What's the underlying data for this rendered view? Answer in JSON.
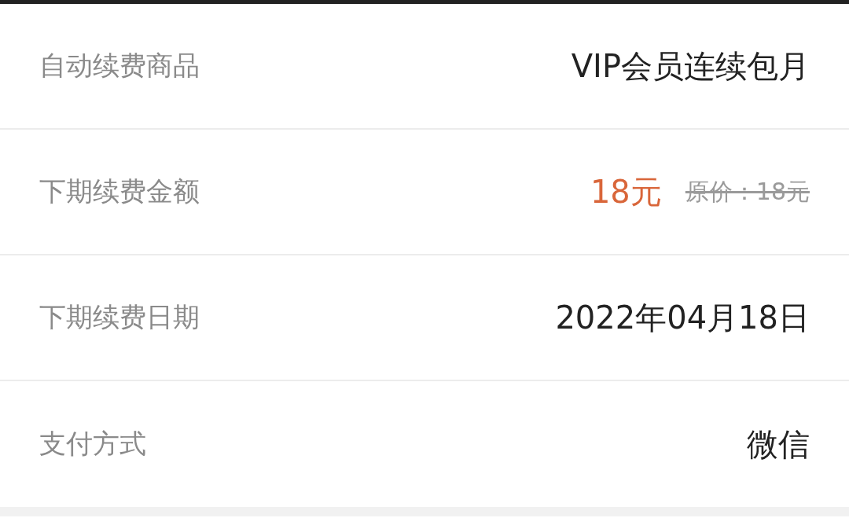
{
  "rows": [
    {
      "kind": "text",
      "label": "自动续费商品",
      "value": "VIP会员连续包月"
    },
    {
      "kind": "price",
      "label": "下期续费金额",
      "value": "18元",
      "original_price": "原价：18元"
    },
    {
      "kind": "text",
      "label": "下期续费日期",
      "value": "2022年04月18日"
    },
    {
      "kind": "text",
      "label": "支付方式",
      "value": "微信"
    }
  ]
}
